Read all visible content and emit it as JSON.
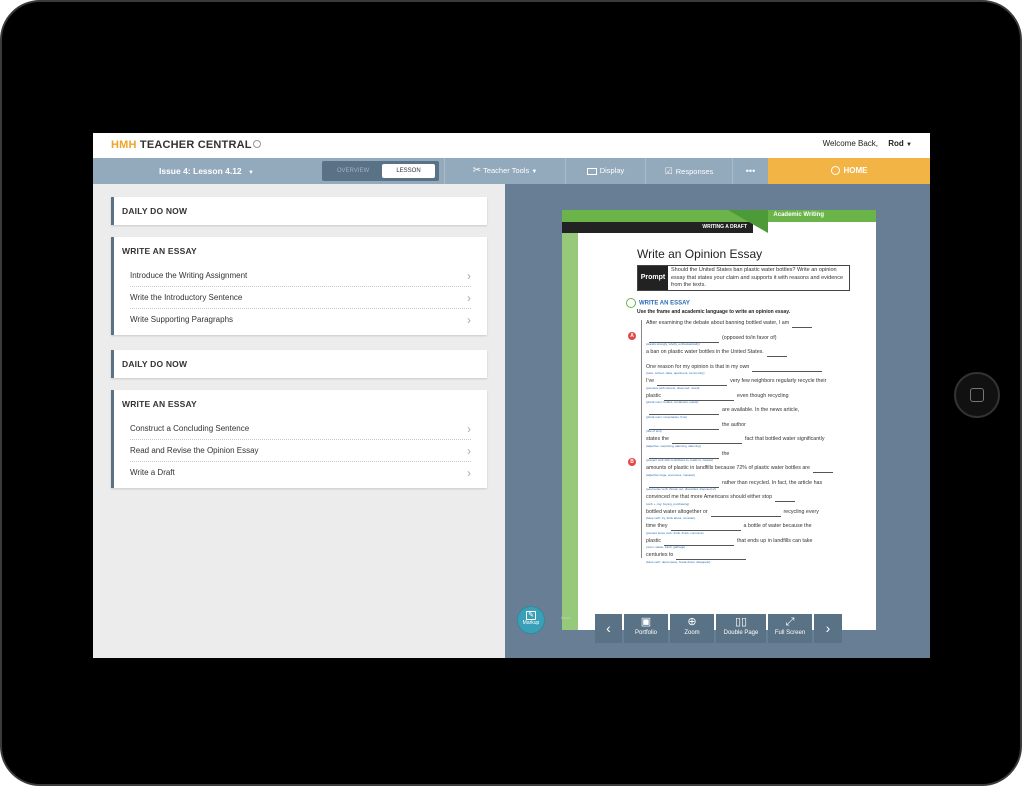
{
  "header": {
    "logo_brand": "HMH",
    "logo_rest": " TEACHER CENTRAL",
    "welcome": "Welcome Back,",
    "user": "Rod"
  },
  "nav": {
    "issue_label": "Issue 4: Lesson 4.12",
    "overview": "OVERVIEW",
    "lesson": "LESSON",
    "teacher_tools": "Teacher Tools",
    "display": "Display",
    "responses": "Responses",
    "more": "•••",
    "home": "HOME"
  },
  "sections": [
    {
      "title": "DAILY DO NOW",
      "items": []
    },
    {
      "title": "WRITE AN ESSAY",
      "items": [
        "Introduce the Writing Assignment",
        "Write the Introductory Sentence",
        "Write Supporting Paragraphs"
      ]
    },
    {
      "title": "DAILY DO NOW",
      "items": []
    },
    {
      "title": "WRITE AN ESSAY",
      "items": [
        "Construct a Concluding Sentence",
        "Read and Revise the Opinion Essay",
        "Write a Draft"
      ]
    }
  ],
  "page": {
    "header_green": "Academic Writing",
    "header_black": "WRITING A DRAFT",
    "title": "Write an Opinion Essay",
    "prompt_tag": "Prompt",
    "prompt_text": "Should the United States ban plastic water bottles? Write an opinion essay that states your claim and supports it with reasons and evidence from the texts.",
    "write_head": "WRITE AN ESSAY",
    "write_sub": "Use the frame and academic language to write an opinion essay.",
    "marker_a": "A",
    "marker_b": "B",
    "lines": [
      {
        "pre": "After examining the debate about banning bottled water, I am",
        "post": "",
        "hint": ""
      },
      {
        "pre": "",
        "post": "(opposed to/in favor of)",
        "hint": "(stands strongly, wholly, enthusiastically)"
      },
      {
        "pre": "a ban on plastic water bottles in the United States.",
        "post": "",
        "hint": ""
      },
      {
        "pre": "One reason for my opinion is that in my own",
        "post": "",
        "hint": "(town, school, class, apartment, community)"
      },
      {
        "pre": "I've",
        "post": "very few neighbors regularly recycle their",
        "hint": "(perceive with interest, observed, noted)"
      },
      {
        "pre": "plastic",
        "post": "even though recycling",
        "hint": "(plural noun: bottles, containers, waste)"
      },
      {
        "pre": "",
        "post": "are available. In the news article,",
        "hint": "(plural noun: receptacles, bins)"
      },
      {
        "pre": "",
        "post": "the author",
        "hint": "(title of text)"
      },
      {
        "pre": "states the",
        "post": "fact that bottled water significantly",
        "hint": "(adjective: surprising, alarming, alarming)"
      },
      {
        "pre": "",
        "post": "the",
        "hint": "(present verb with contributes to, leads to, causes)"
      },
      {
        "pre": "amounts of plastic in landfills because 72% of plastic water bottles are",
        "post": "",
        "hint": "(adjective huge, enormous, massive)"
      },
      {
        "pre": "",
        "post": "rather than recycled. In fact, the article has",
        "hint": "(past tense verb: thrown out, discarded, disposed of)"
      },
      {
        "pre": "convinced me that more Americans should either stop",
        "post": "",
        "hint": "(verb + -ing: buying, purchasing)"
      },
      {
        "pre": "bottled water altogether or",
        "post": "recycling every",
        "hint": "(base verb: try, think about, consider)"
      },
      {
        "pre": "time they",
        "post": "a bottle of water because the",
        "hint": "(present tense verb: drink, finish, consume)"
      },
      {
        "pre": "plastic",
        "post": "that ends up in landfills can take",
        "hint": "(noun: waste, trash, garbage)"
      },
      {
        "pre": "centuries to",
        "post": "",
        "hint": "(base verb: decompose, break down, disappear)"
      }
    ]
  },
  "viewer": {
    "markup": "Markup",
    "issue_strip": "Issue",
    "prev": "‹",
    "portfolio": "Portfolio",
    "zoom": "Zoom",
    "double_page": "Double Page",
    "full_screen": "Full Screen",
    "next": "›"
  }
}
